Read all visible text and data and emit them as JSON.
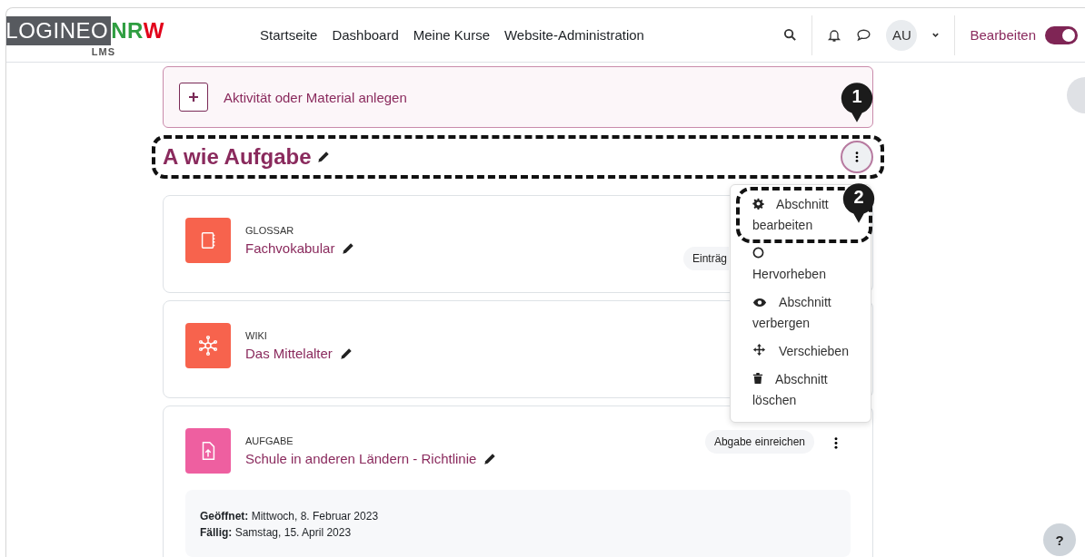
{
  "header": {
    "logo": {
      "parts": [
        {
          "text": "LOGINEO",
          "kind": "boxed"
        },
        {
          "text": "NR",
          "kind": "plain",
          "color": "#2f9e41"
        },
        {
          "text": "W",
          "kind": "plain",
          "color": "#e2001a"
        }
      ],
      "subtitle": "LMS"
    },
    "nav": [
      "Startseite",
      "Dashboard",
      "Meine Kurse",
      "Website-Administration"
    ],
    "user": {
      "initials": "AU"
    },
    "edit_mode": {
      "label": "Bearbeiten",
      "on": true
    }
  },
  "add_activity": {
    "label": "Aktivität oder Material anlegen"
  },
  "section": {
    "title": "A wie Aufgabe",
    "highlighted": true
  },
  "section_menu": {
    "expanded": true,
    "items": [
      {
        "label": "Abschnitt bearbeiten",
        "kind": "gear",
        "highlighted": true
      },
      {
        "label": "Hervorheben",
        "kind": "circle"
      },
      {
        "label": "Abschnitt verbergen",
        "kind": "eye"
      },
      {
        "label": "Verschieben",
        "kind": "move"
      },
      {
        "label": "Abschnitt löschen",
        "kind": "trash"
      }
    ]
  },
  "activities": [
    {
      "type": "GLOSSAR",
      "kind": "glossary",
      "title": "Fachvokabular",
      "badge": "Einträg"
    },
    {
      "type": "WIKI",
      "kind": "wiki",
      "title": "Das Mittelalter"
    },
    {
      "type": "AUFGABE",
      "kind": "assignment",
      "title": "Schule in anderen Ländern - Richtlinie",
      "badge": "Abgabe einreichen",
      "has_menu": true,
      "dates": [
        {
          "label": "Geöffnet:",
          "value": "Mittwoch, 8. Februar 2023"
        },
        {
          "label": "Fällig:",
          "value": "Samstag, 15. April 2023"
        }
      ]
    }
  ],
  "annotations": [
    {
      "number": "1"
    },
    {
      "number": "2"
    }
  ],
  "help": {
    "label": "?"
  }
}
